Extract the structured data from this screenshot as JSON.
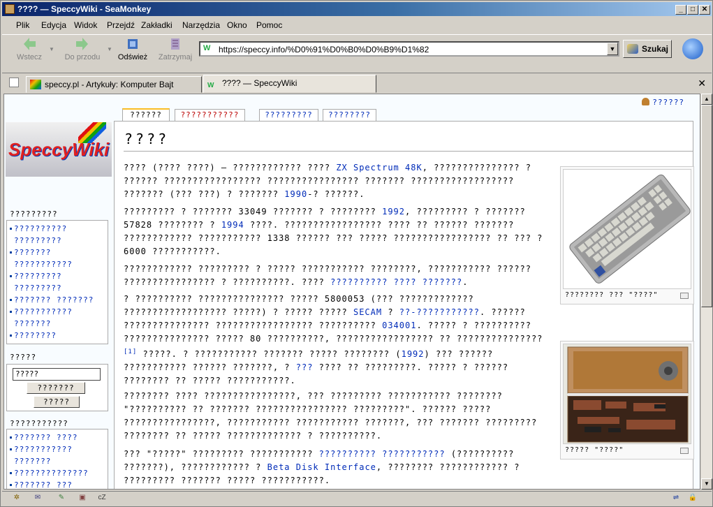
{
  "window": {
    "title": "???? — SpeccyWiki - SeaMonkey"
  },
  "menu": [
    "Plik",
    "Edycja",
    "Widok",
    "Przejdź",
    "Zakładki",
    "Narzędzia",
    "Okno",
    "Pomoc"
  ],
  "toolbar": {
    "back": "Wstecz",
    "forward": "Do przodu",
    "reload": "Odśwież",
    "stop": "Zatrzymaj",
    "url": "https://speccy.info/%D0%91%D0%B0%D0%B9%D1%82",
    "search": "Szukaj"
  },
  "tabs": [
    {
      "label": "speccy.pl - Artykuły: Komputer Bajt"
    },
    {
      "label": "???? — SpeccyWiki"
    }
  ],
  "page": {
    "user_link": "??????",
    "ptabs": [
      "??????",
      "???????????",
      "?????????",
      "????????"
    ],
    "heading": "????",
    "nav_header": "?????????",
    "nav_items": [
      "?????????? ?????????",
      "??????? ???????????",
      "????????? ?????????",
      "??????? ???????",
      "??????????? ???????",
      "????????"
    ],
    "search_header": "?????",
    "search_value": "?????",
    "search_go": "???????",
    "search_find": "?????",
    "tools_header": "???????????",
    "tools_items": [
      "??????? ????",
      "??????????? ???????",
      "??????????????",
      "??????? ???"
    ],
    "p1a": "???? (???? ????) — ???????????? ???? ",
    "p1link": "ZX Spectrum 48K",
    "p1b": ", ??????????????? ? ?????? ????????????????? ???????????????? ??????? ?????????????????? ??????? (??? ???) ? ??????? ",
    "p1link2": "1990",
    "p1c": "-? ??????.",
    "p2a": "????????? ? ??????? 33049 ??????? ? ???????? ",
    "p2l1": "1992",
    "p2b": ", ????????? ? ??????? 57828 ???????? ? ",
    "p2l2": "1994",
    "p2c": " ????. ????????????????? ???? ?? ?????? ??????? ???????????? ??????????? 1338 ?????? ??? ????? ????????????????? ?? ??? ? 6000 ???????????.",
    "p3a": "???????????? ????????? ? ????? ??????????? ????????, ??????????? ?????? ???????????????? ? ??????????. ???? ",
    "p3link": "?????????? ???? ???????",
    "p3b": ".",
    "p4a": "? ?????????? ??????????????? ????? 5800053 (??? ????????????? ?????????????????? ?????) ? ????? ????? ",
    "p4l1": "SECAM",
    "p4b": " ? ",
    "p4l2": "??-???????????",
    "p4c": ". ?????? ??????????????? ????????????????? ?????????? ",
    "p4l3": "034001",
    "p4d": ". ????? ? ?????????? ??????????????? ????? 80 ??????????, ????????????????? ?? ???????????????",
    "p4sup": "[1]",
    "p4e": " ?????. ? ??????????? ??????? ????? ???????? (",
    "p4l4": "1992",
    "p4f": ") ??? ?????? ??????????? ?????? ???????, ? ",
    "p4l5": "???",
    "p4g": " ???? ?? ?????????. ????? ? ?????? ???????? ?? ????? ???????????.",
    "p5": "???????? ???? ????????????????, ??? ????????? ??????????? ???????? \"?????????? ?? ??????? ???????????????? ?????????\". ?????? ????? ????????????????, ??????????? ??????????? ???????, ??? ??????? ????????? ???????? ?? ????? ????????????? ? ??????????.",
    "p6a": "??? \"?????\" ????????? ??????????? ",
    "p6l1": "?????????? ???????????",
    "p6b": " (?????????? ???????), ???????????? ? ",
    "p6l2": "Beta Disk Interface",
    "p6c": ", ???????? ???????????? ? ????????? ??????? ????? ???????????.",
    "thumb1_caption": "???????? ??? \"????\"",
    "thumb2_caption": "????? \"????\""
  }
}
